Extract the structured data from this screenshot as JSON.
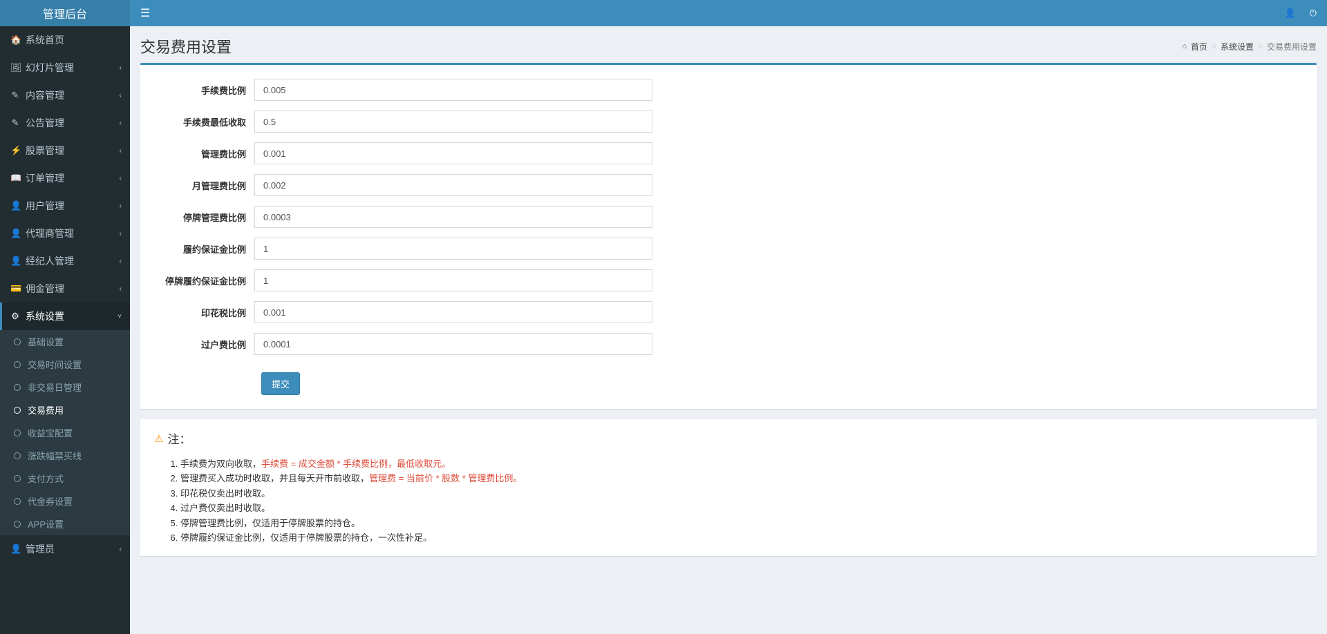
{
  "brand": "管理后台",
  "nav": [
    {
      "icon": "🏠",
      "label": "系统首页",
      "hasSub": false
    },
    {
      "icon": "🖼",
      "label": "幻灯片管理",
      "hasSub": true
    },
    {
      "icon": "✎",
      "label": "内容管理",
      "hasSub": true
    },
    {
      "icon": "✎",
      "label": "公告管理",
      "hasSub": true
    },
    {
      "icon": "⚡",
      "label": "股票管理",
      "hasSub": true
    },
    {
      "icon": "📖",
      "label": "订单管理",
      "hasSub": true
    },
    {
      "icon": "👤",
      "label": "用户管理",
      "hasSub": true
    },
    {
      "icon": "👤",
      "label": "代理商管理",
      "hasSub": true
    },
    {
      "icon": "👤",
      "label": "经纪人管理",
      "hasSub": true
    },
    {
      "icon": "💳",
      "label": "佣金管理",
      "hasSub": true
    },
    {
      "icon": "⚙",
      "label": "系统设置",
      "hasSub": true,
      "active": true,
      "open": true
    },
    {
      "icon": "👤",
      "label": "管理员",
      "hasSub": true
    }
  ],
  "subNav": [
    {
      "label": "基础设置"
    },
    {
      "label": "交易时间设置"
    },
    {
      "label": "非交易日管理"
    },
    {
      "label": "交易费用",
      "active": true
    },
    {
      "label": "收益宝配置"
    },
    {
      "label": "涨跌幅禁买线"
    },
    {
      "label": "支付方式"
    },
    {
      "label": "代金券设置"
    },
    {
      "label": "APP设置"
    }
  ],
  "header": {
    "title": "交易费用设置",
    "breadcrumb": {
      "home": "首页",
      "parent": "系统设置",
      "current": "交易费用设置"
    }
  },
  "form": {
    "fields": [
      {
        "label": "手续费比例",
        "value": "0.005"
      },
      {
        "label": "手续费最低收取",
        "value": "0.5"
      },
      {
        "label": "管理费比例",
        "value": "0.001"
      },
      {
        "label": "月管理费比例",
        "value": "0.002"
      },
      {
        "label": "停牌管理费比例",
        "value": "0.0003"
      },
      {
        "label": "履约保证金比例",
        "value": "1"
      },
      {
        "label": "停牌履约保证金比例",
        "value": "1"
      },
      {
        "label": "印花税比例",
        "value": "0.001"
      },
      {
        "label": "过户费比例",
        "value": "0.0001"
      }
    ],
    "submit": "提交"
  },
  "note": {
    "title": "注：",
    "items": [
      {
        "pre": "手续费为双向收取，",
        "red": "手续费 = 成交金额 * 手续费比例，最低收取元。",
        "post": ""
      },
      {
        "pre": "管理费买入成功时收取，并且每天开市前收取，",
        "red": "管理费 = 当前价 * 股数 * 管理费比例。",
        "post": ""
      },
      {
        "pre": "印花税仅卖出时收取。",
        "red": "",
        "post": ""
      },
      {
        "pre": "过户费仅卖出时收取。",
        "red": "",
        "post": ""
      },
      {
        "pre": "停牌管理费比例，仅适用于停牌股票的持仓。",
        "red": "",
        "post": ""
      },
      {
        "pre": "停牌履约保证金比例，仅适用于停牌股票的持仓，一次性补足。",
        "red": "",
        "post": ""
      }
    ]
  }
}
